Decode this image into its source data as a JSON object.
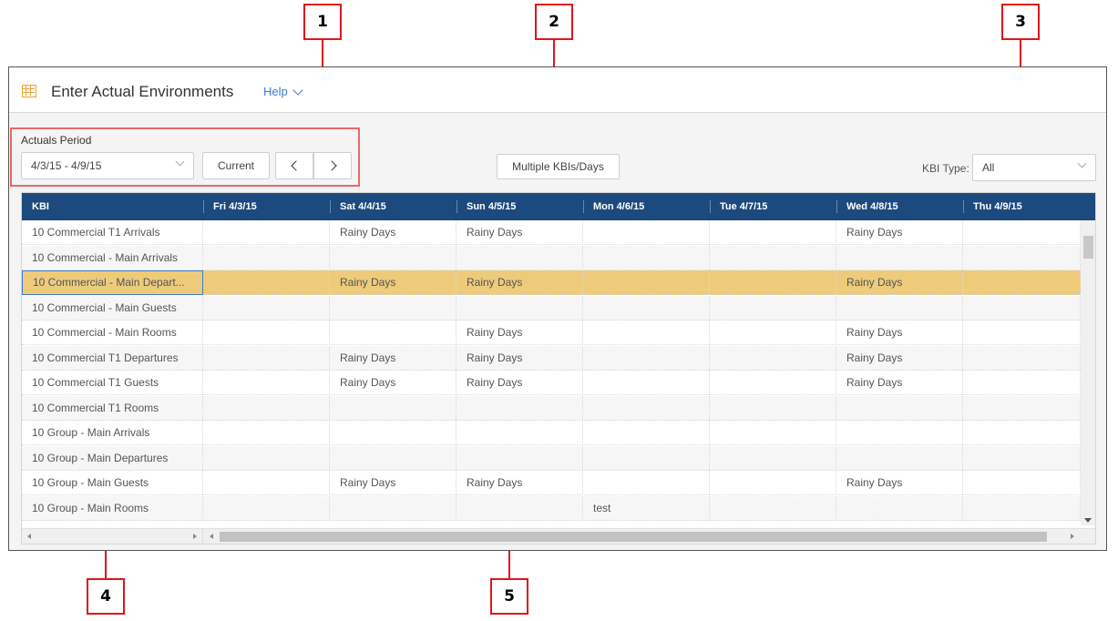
{
  "callouts": [
    "1",
    "2",
    "3",
    "4",
    "5"
  ],
  "app": {
    "title": "Enter Actual Environments",
    "help_label": "Help",
    "grid_icon": "table-grid-icon"
  },
  "toolbar": {
    "period_label": "Actuals Period",
    "period_value": "4/3/15 - 4/9/15",
    "current_label": "Current",
    "prev_icon": "chevron-left-icon",
    "next_icon": "chevron-right-icon",
    "multiple_label": "Multiple KBIs/Days",
    "kbi_type_label": "KBI Type:",
    "kbi_type_value": "All"
  },
  "grid": {
    "columns": [
      "KBI",
      "Fri 4/3/15",
      "Sat 4/4/15",
      "Sun 4/5/15",
      "Mon 4/6/15",
      "Tue 4/7/15",
      "Wed 4/8/15",
      "Thu 4/9/15"
    ],
    "rows": [
      {
        "kbi": "10 Commercial T1 Arrivals",
        "cells": [
          "",
          "Rainy Days",
          "Rainy Days",
          "",
          "",
          "Rainy Days",
          ""
        ]
      },
      {
        "kbi": "10 Commercial - Main Arrivals",
        "cells": [
          "",
          "",
          "",
          "",
          "",
          "",
          ""
        ]
      },
      {
        "kbi": "10 Commercial - Main Depart...",
        "cells": [
          "",
          "Rainy Days",
          "Rainy Days",
          "",
          "",
          "Rainy Days",
          ""
        ],
        "selected": true
      },
      {
        "kbi": "10 Commercial - Main Guests",
        "cells": [
          "",
          "",
          "",
          "",
          "",
          "",
          ""
        ]
      },
      {
        "kbi": "10 Commercial - Main Rooms",
        "cells": [
          "",
          "",
          "Rainy Days",
          "",
          "",
          "Rainy Days",
          ""
        ]
      },
      {
        "kbi": "10 Commercial T1 Departures",
        "cells": [
          "",
          "Rainy Days",
          "Rainy Days",
          "",
          "",
          "Rainy Days",
          ""
        ]
      },
      {
        "kbi": "10 Commercial T1 Guests",
        "cells": [
          "",
          "Rainy Days",
          "Rainy Days",
          "",
          "",
          "Rainy Days",
          ""
        ]
      },
      {
        "kbi": "10 Commercial T1 Rooms",
        "cells": [
          "",
          "",
          "",
          "",
          "",
          "",
          ""
        ]
      },
      {
        "kbi": "10 Group - Main Arrivals",
        "cells": [
          "",
          "",
          "",
          "",
          "",
          "",
          ""
        ]
      },
      {
        "kbi": "10 Group - Main Departures",
        "cells": [
          "",
          "",
          "",
          "",
          "",
          "",
          ""
        ]
      },
      {
        "kbi": "10 Group - Main Guests",
        "cells": [
          "",
          "Rainy Days",
          "Rainy Days",
          "",
          "",
          "Rainy Days",
          ""
        ]
      },
      {
        "kbi": "10 Group - Main Rooms",
        "cells": [
          "",
          "",
          "",
          "test",
          "",
          "",
          ""
        ]
      }
    ]
  },
  "colors": {
    "header_bg": "#1c4a7e",
    "selected_row": "#edcb7a",
    "callout_red": "#e0151b",
    "help_link": "#3a7bd5"
  }
}
